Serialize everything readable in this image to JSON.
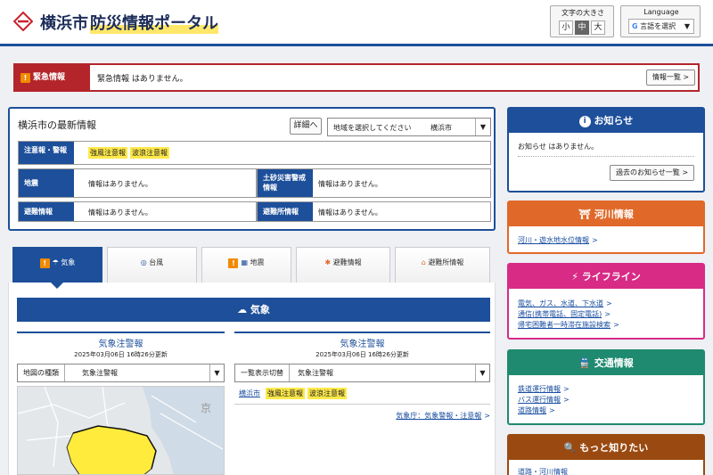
{
  "header": {
    "city": "横浜市",
    "portal_title": "防災情報ポータル",
    "font_size_label": "文字の大きさ",
    "font_sizes": [
      "小",
      "中",
      "大"
    ],
    "language_label": "Language",
    "language_select": "言語を選択"
  },
  "emergency": {
    "tag": "緊急情報",
    "text": "緊急情報 はありません。",
    "list_button": "情報一覧 >"
  },
  "latest": {
    "title": "横浜市の最新情報",
    "detail_button": "詳細へ",
    "region_placeholder": "地域を選択してください",
    "region_value": "横浜市",
    "rows": [
      {
        "label": "注意報・警報",
        "tags": [
          "強風注意報",
          "波浪注意報"
        ]
      },
      {
        "label": "地震",
        "value": "情報はありません。"
      },
      {
        "label": "土砂災害警戒情報",
        "value": "情報はありません。"
      },
      {
        "label": "避難情報",
        "value": "情報はありません。"
      },
      {
        "label": "避難所情報",
        "value": "情報はありません。"
      }
    ]
  },
  "tabs": [
    {
      "label": "気象",
      "icon": "cloud-rain-icon"
    },
    {
      "label": "台風",
      "icon": "typhoon-icon"
    },
    {
      "label": "地震",
      "icon": "earthquake-icon"
    },
    {
      "label": "避難情報",
      "icon": "evacuation-icon"
    },
    {
      "label": "避難所情報",
      "icon": "shelter-icon"
    }
  ],
  "weather": {
    "band_title": "気象",
    "left": {
      "title": "気象注警報",
      "updated": "2025年03月06日 16時26分更新",
      "select_label": "地図の種類",
      "select_value": "気象注警報"
    },
    "right": {
      "title": "気象注警報",
      "updated": "2025年03月06日 16時26分更新",
      "select_label": "一覧表示切替",
      "select_value": "気象注警報",
      "city_link": "横浜市",
      "tags": [
        "強風注意報",
        "波浪注意報"
      ],
      "jma_link": "気象庁：気象警報・注意報"
    }
  },
  "notice": {
    "title": "お知らせ",
    "text": "お知らせ はありません。",
    "past_button": "過去のお知らせ一覧 >"
  },
  "river": {
    "title": "河川情報",
    "links": [
      "河川・遊水地水位情報"
    ],
    "color": "#e0692a"
  },
  "lifeline": {
    "title": "ライフライン",
    "links": [
      "電気、ガス、水道、下水道",
      "通信(携帯電話、固定電話)",
      "帰宅困難者一時滞在施設検索"
    ],
    "color": "#d72b86"
  },
  "transport": {
    "title": "交通情報",
    "links": [
      "鉄道運行情報",
      "バス運行情報",
      "道路情報"
    ],
    "color": "#1f8a70"
  },
  "more": {
    "title": "もっと知りたい",
    "links": [
      "道路・河川情報"
    ],
    "color": "#9a4a10"
  },
  "colors": {
    "primary": "#1d4f9a",
    "emergency": "#b3252b",
    "warning_tag": "#ffe94a",
    "warning_icon": "#f18a00"
  }
}
